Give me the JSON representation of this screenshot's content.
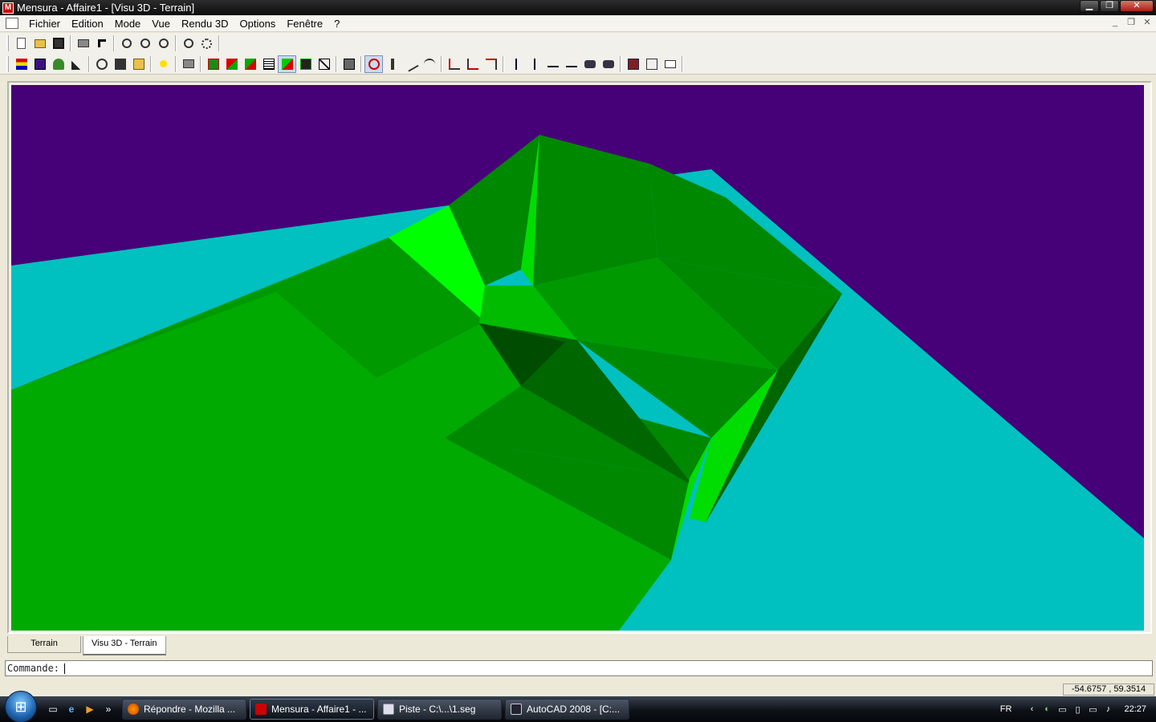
{
  "window": {
    "title": "Mensura - Affaire1 - [Visu 3D - Terrain]",
    "app_icon_glyph": "M",
    "controls": [
      "minimize",
      "restore",
      "close"
    ],
    "control_glyphs": [
      "▁",
      "❐",
      "✕"
    ]
  },
  "menu": [
    "Fichier",
    "Edition",
    "Mode",
    "Vue",
    "Rendu 3D",
    "Options",
    "Fenêtre",
    "?"
  ],
  "mdi_glyphs": [
    "_",
    "❐",
    "✕"
  ],
  "toolbar1": [
    "new-icon",
    "open-icon",
    "save-icon",
    "print-icon",
    "help-pointer-icon",
    "zoom-in-icon",
    "zoom-out-icon",
    "zoom-window-icon",
    "zoom-all-icon",
    "zoom-extents-icon"
  ],
  "toolbar2": [
    "layers-icon",
    "color-icon",
    "tree-icon",
    "brush-icon",
    "globe-icon",
    "save-view-icon",
    "open-view-icon",
    "light-icon",
    "print-3d-icon",
    "render-icon",
    "shade-icon",
    "flat-icon",
    "grid-icon",
    "surface-icon",
    "mesh-icon",
    "wire-icon",
    "snapshot-icon",
    "orbit-icon",
    "walk-icon",
    "cut-icon",
    "curve-icon",
    "rotate-x-icon",
    "rotate-y-icon",
    "rotate-z-icon",
    "axis-icon",
    "axis-2-icon",
    "arrow-left-icon",
    "arrow-right-icon",
    "camera-icon",
    "camera-2-icon",
    "windows-icon",
    "properties-icon",
    "comment-icon"
  ],
  "viewport": {
    "sky_color": "#460078",
    "water_color": "#00c0c0",
    "terrain_colors": [
      "#00aa00",
      "#009900",
      "#008800",
      "#006600",
      "#004c00",
      "#00dd00",
      "#00ff00",
      "#00bb00"
    ]
  },
  "tabs": [
    "Terrain",
    "Visu 3D - Terrain"
  ],
  "command": {
    "label": "Commande:"
  },
  "status": {
    "coords": "-54.6757 , 59.3514"
  },
  "taskbar": {
    "start_glyph": "⊞",
    "quicklaunch_glyphs": [
      "▭",
      "e",
      "▶",
      "»"
    ],
    "tasks": [
      {
        "label": "Répondre - Mozilla ...",
        "icon": "firefox-icon",
        "active": false
      },
      {
        "label": "Mensura - Affaire1 - ...",
        "icon": "mensura-icon",
        "active": true
      },
      {
        "label": "Piste - C:\\...\\1.seg",
        "icon": "piste-icon",
        "active": false
      },
      {
        "label": "AutoCAD 2008 - [C:...",
        "icon": "autocad-icon",
        "active": false
      }
    ],
    "language": "FR",
    "tray_glyphs": [
      "‹",
      "◐",
      "▭",
      "▯",
      "▭",
      "♪"
    ],
    "clock": "22:27"
  }
}
